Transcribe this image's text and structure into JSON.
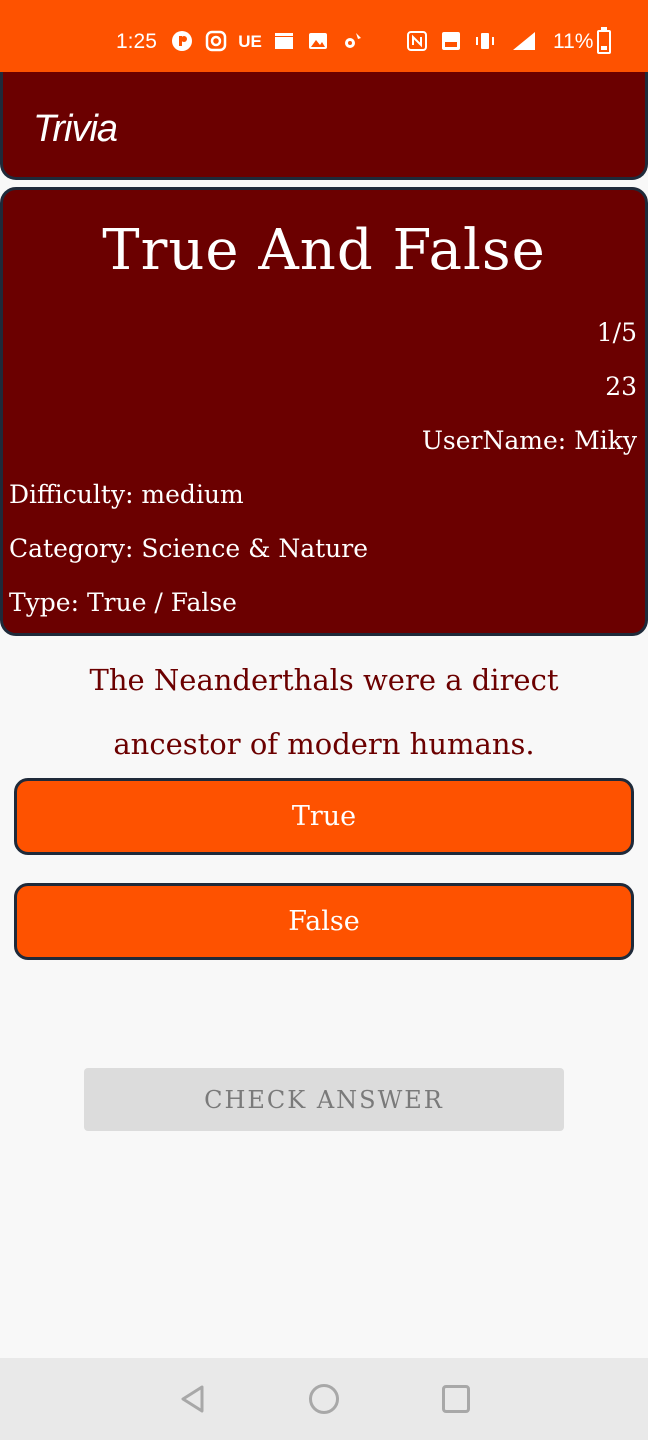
{
  "status_bar": {
    "time": "1:25",
    "battery": "11%",
    "icons_left": [
      "app-icon",
      "instagram-icon",
      "ue-icon",
      "clapper-icon",
      "image-icon",
      "settings-icon"
    ],
    "icons_right": [
      "nfc-icon",
      "volte-icon",
      "vibrate-icon",
      "signal-5g-icon"
    ],
    "ue_label": "UE"
  },
  "app_bar": {
    "title": "Trivia"
  },
  "info_card": {
    "title": "True And False",
    "progress": "1/5",
    "score": "23",
    "username": "UserName: Miky",
    "difficulty": "Difficulty: medium",
    "category": "Category: Science & Nature",
    "type": "Type: True / False"
  },
  "question": {
    "text": "The Neanderthals were a direct ancestor of modern humans."
  },
  "answers": {
    "true_label": "True",
    "false_label": "False"
  },
  "check": {
    "label": "CHECK ANSWER"
  },
  "colors": {
    "accent": "#fe5200",
    "dark_red": "#6b0000",
    "border": "#1f2a3a"
  }
}
